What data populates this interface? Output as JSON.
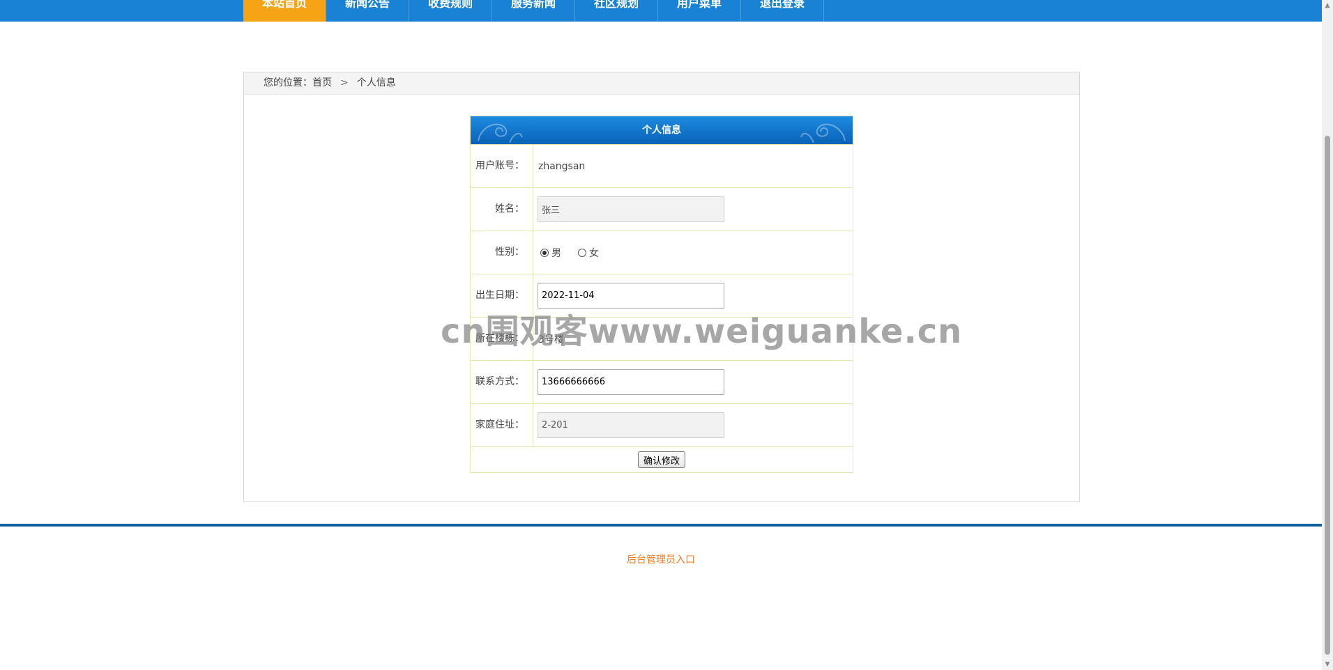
{
  "nav": {
    "items": [
      {
        "label": "本站首页"
      },
      {
        "label": "新闻公告"
      },
      {
        "label": "收费规则"
      },
      {
        "label": "服务新闻"
      },
      {
        "label": "社区规划"
      },
      {
        "label": "用户菜单"
      },
      {
        "label": "退出登录"
      }
    ],
    "active_color": "#f6a315",
    "bar_color": "#1a82d4"
  },
  "breadcrumb": {
    "prefix": "您的位置：",
    "home": "首页",
    "separator": ">",
    "current": "个人信息"
  },
  "form": {
    "title": "个人信息",
    "account_label": "用户账号：",
    "account_value": "zhangsan",
    "name_label": "姓名：",
    "name_value": "张三",
    "gender_label": "性别：",
    "gender_male": "男",
    "gender_female": "女",
    "gender_selected": "男",
    "birth_label": "出生日期：",
    "birth_value": "2022-11-04",
    "building_label": "所在楼栋：",
    "building_value": "3号楼",
    "phone_label": "联系方式：",
    "phone_value": "13666666666",
    "address_label": "家庭住址：",
    "address_value": "2-201",
    "submit_label": "确认修改"
  },
  "watermark": "cn围观客www.weiguanke.cn",
  "footer": {
    "admin_link": "后台管理员入口",
    "link_color": "#f47b20"
  }
}
